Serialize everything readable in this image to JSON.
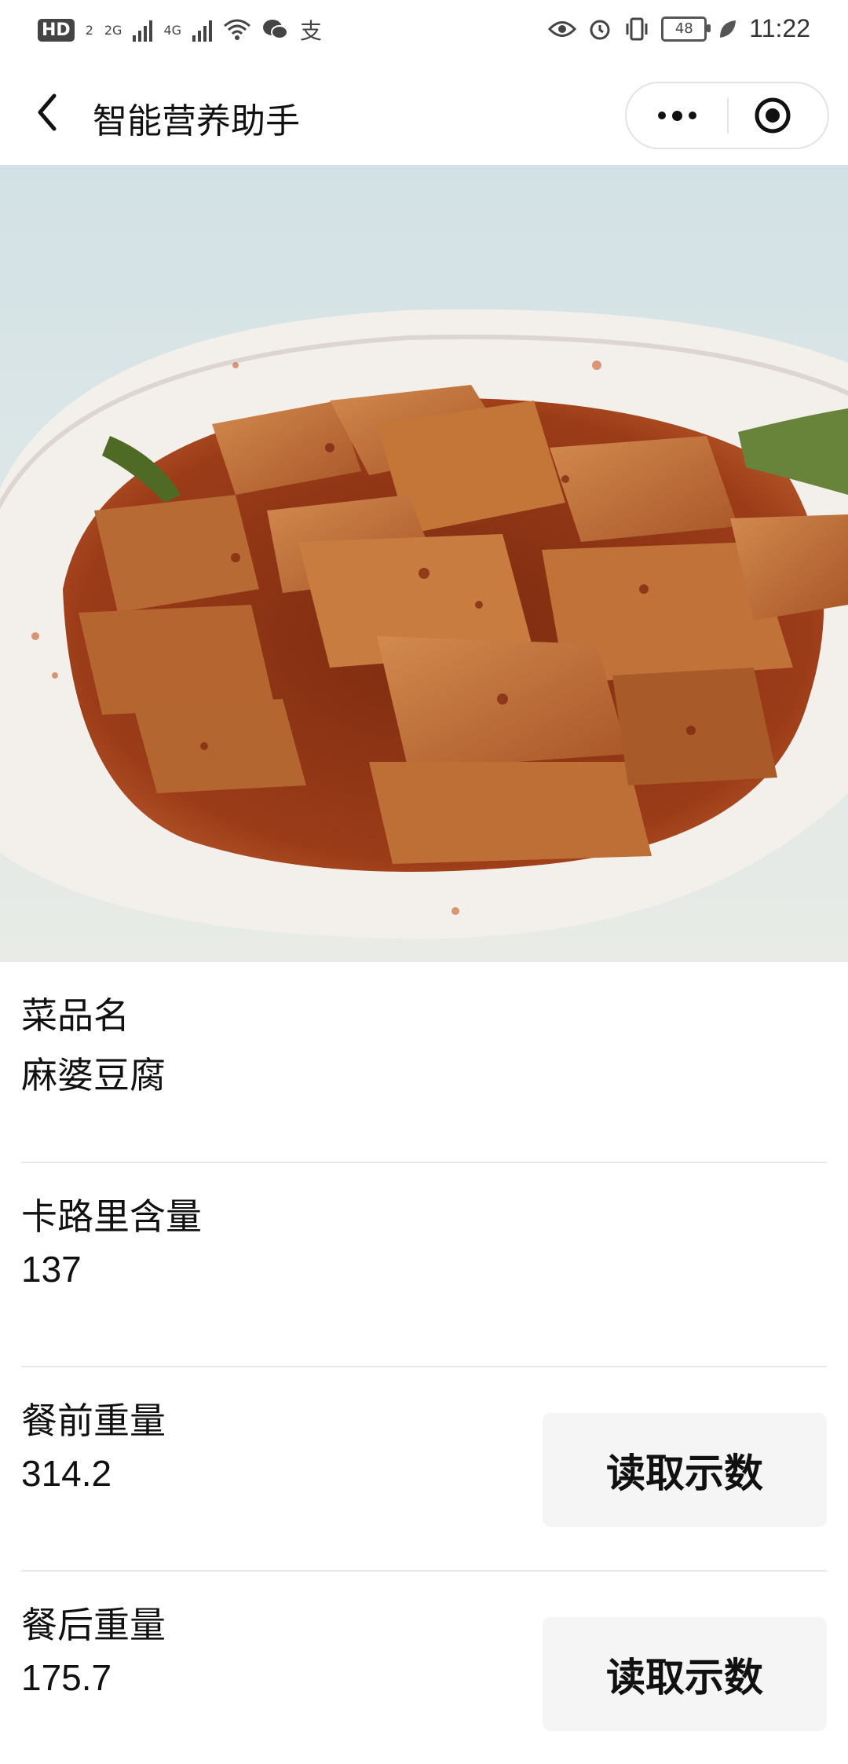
{
  "status_bar": {
    "left_badge": "HD",
    "left_badge_sub": "2",
    "network_1": "2G",
    "network_2": "4G",
    "icons_left": [
      "signal-icon",
      "wifi-icon",
      "wechat-icon",
      "alipay-icon"
    ],
    "alipay_glyph": "支",
    "icons_right": [
      "eye-icon",
      "alarm-icon",
      "vibrate-icon",
      "battery-icon",
      "leaf-icon"
    ],
    "battery": "48",
    "time": "11:22"
  },
  "navbar": {
    "title": "智能营养助手",
    "back_icon": "chevron-left-icon",
    "more_icon": "more-dots-icon",
    "close_icon": "target-circle-icon"
  },
  "photo": {
    "subject": "mapo-tofu-dish",
    "colors": {
      "plate": "#f4f1ee",
      "sauce": "#8e3a17",
      "tofu": "#c0703a",
      "scallion": "#5d7a2a"
    }
  },
  "fields": [
    {
      "label": "菜品名",
      "value": "麻婆豆腐"
    },
    {
      "label": "卡路里含量",
      "value": "137"
    },
    {
      "label": "餐前重量",
      "value": "314.2",
      "button": "读取示数"
    },
    {
      "label": "餐后重量",
      "value": "175.7",
      "button": "读取示数"
    }
  ]
}
